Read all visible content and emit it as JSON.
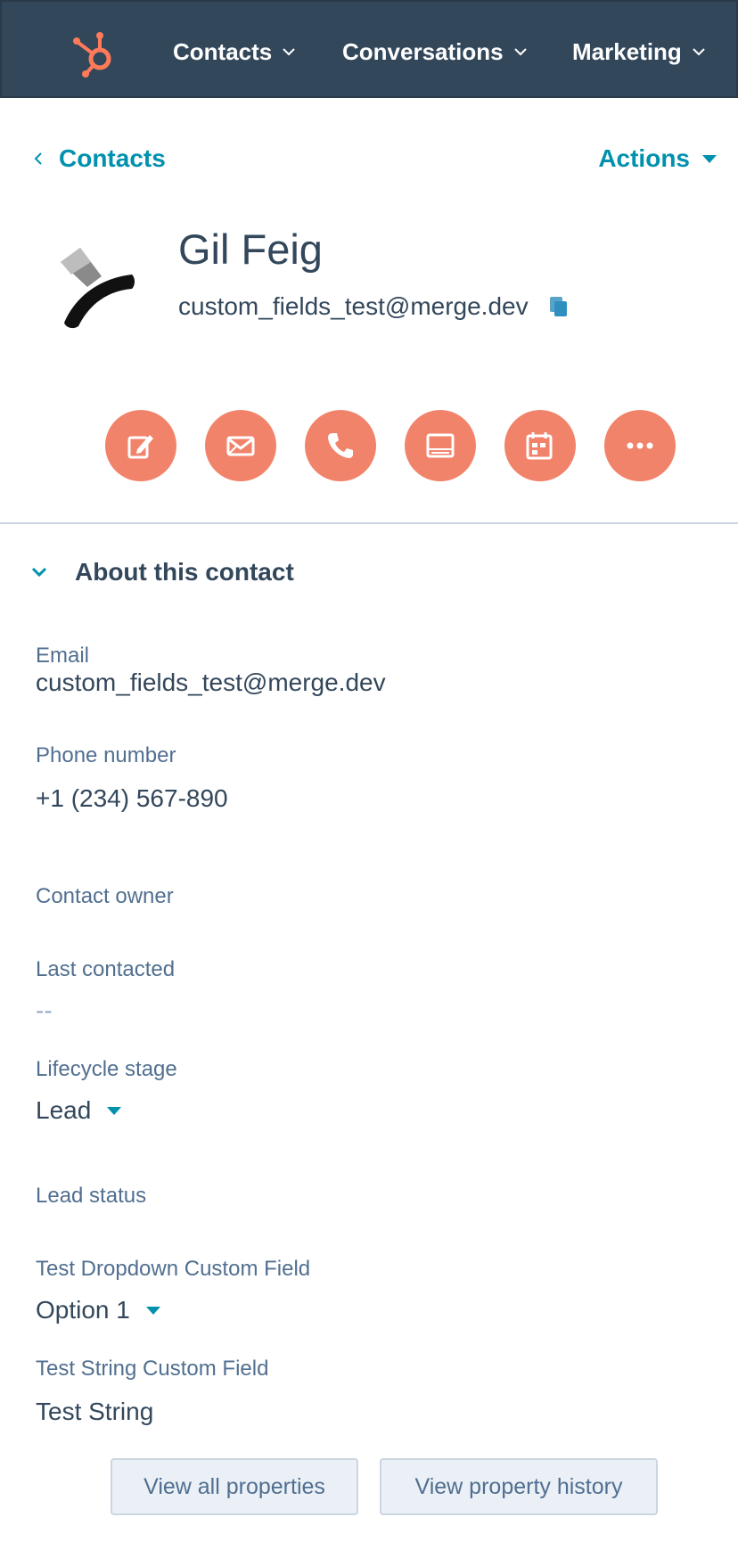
{
  "nav": {
    "items": [
      {
        "label": "Contacts"
      },
      {
        "label": "Conversations"
      },
      {
        "label": "Marketing"
      }
    ]
  },
  "breadcrumb": {
    "label": "Contacts"
  },
  "actions": {
    "label": "Actions"
  },
  "contact": {
    "name": "Gil Feig",
    "email": "custom_fields_test@merge.dev"
  },
  "quick_actions": [
    "note-icon",
    "email-icon",
    "phone-icon",
    "task-icon",
    "meeting-icon",
    "more-icon"
  ],
  "about": {
    "title": "About this contact",
    "fields": {
      "email": {
        "label": "Email",
        "value": "custom_fields_test@merge.dev"
      },
      "phone": {
        "label": "Phone number",
        "value": "+1 (234) 567-890"
      },
      "owner": {
        "label": "Contact owner"
      },
      "last_contacted": {
        "label": "Last contacted",
        "value": "--"
      },
      "lifecycle": {
        "label": "Lifecycle stage",
        "value": "Lead"
      },
      "lead_status": {
        "label": "Lead status"
      },
      "dropdown_custom": {
        "label": "Test Dropdown Custom Field",
        "value": "Option 1"
      },
      "string_custom": {
        "label": "Test String Custom Field",
        "value": "Test String"
      }
    }
  },
  "buttons": {
    "view_all": "View all properties",
    "view_history": "View property history"
  },
  "colors": {
    "nav_bg": "#33475b",
    "accent": "#0091ae",
    "action_circle": "#f2836b",
    "brand": "#ff7a59"
  }
}
